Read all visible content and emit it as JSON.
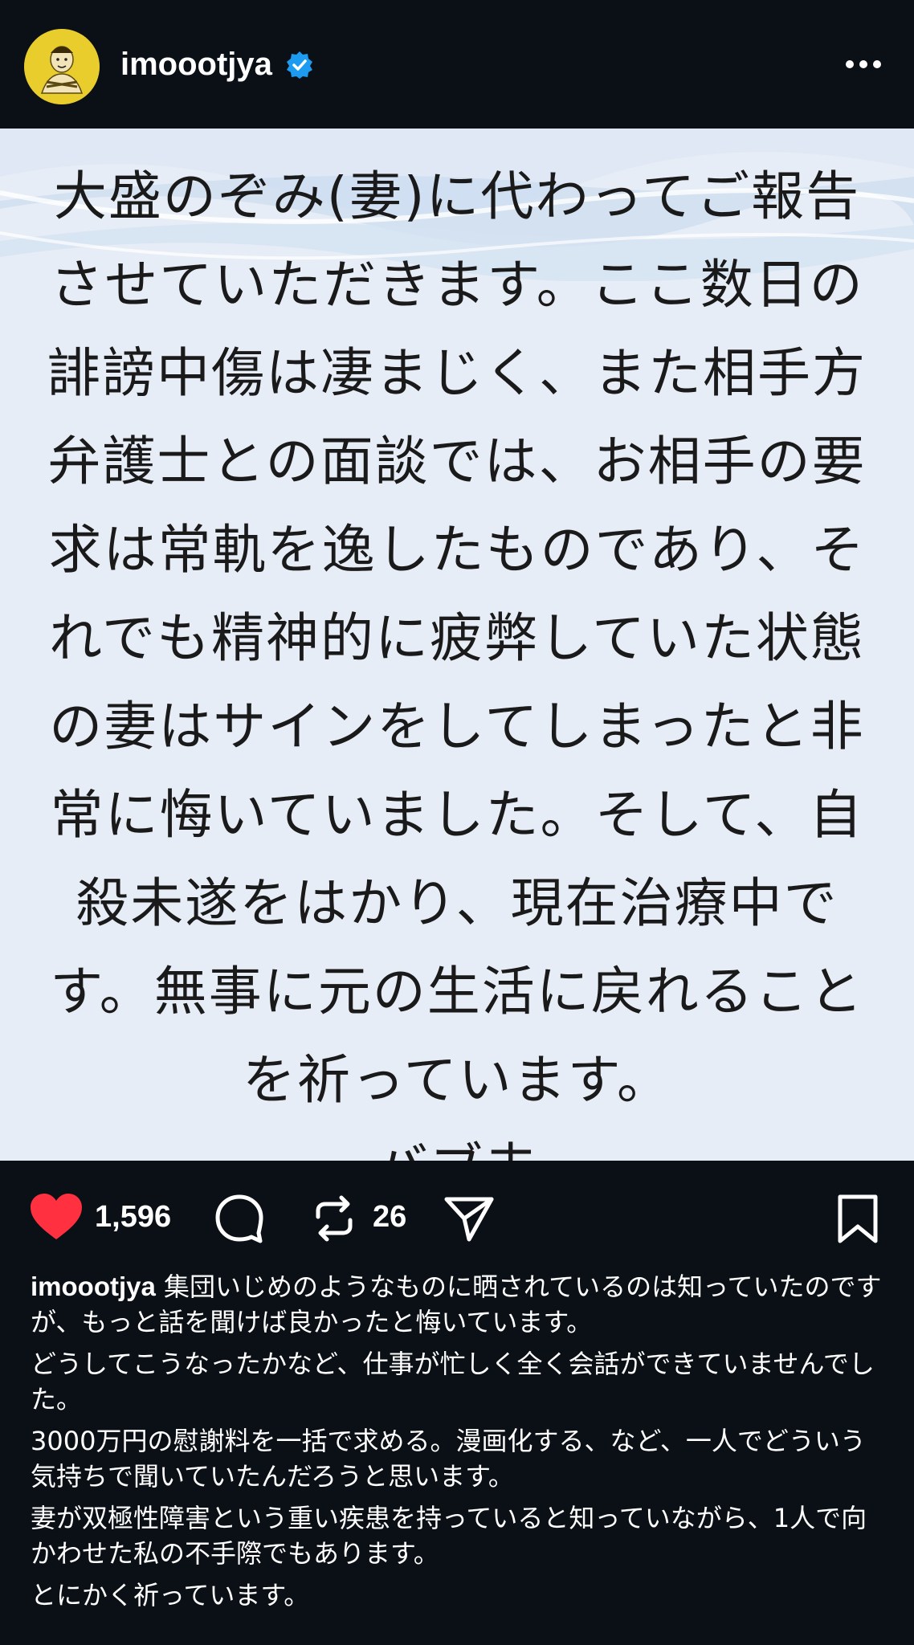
{
  "header": {
    "username": "imoootjya",
    "verified_icon": "verified-badge-icon",
    "more_icon": "more-horizontal-icon",
    "accent_color": "#1d9bf0"
  },
  "post": {
    "text": "大盛のぞみ(妻)に代わってご報告\nさせていただきます。ここ数日の\n誹謗中傷は凄まじく、また相手方\n弁護士との面談では、お相手の要\n求は常軌を逸したものであり、そ\nれでも精神的に疲弊していた状態\nの妻はサインをしてしまったと非\n常に悔いていました。そして、自\n殺未遂をはかり、現在治療中で\nす。無事に元の生活に戻れること\nを祈っています。\nバブ夫"
  },
  "actions": {
    "like_icon": "heart-filled-icon",
    "like_color": "#ff3040",
    "likes": "1,596",
    "comment_icon": "comment-icon",
    "repost_icon": "repost-icon",
    "reposts": "26",
    "share_icon": "send-icon",
    "save_icon": "bookmark-icon"
  },
  "caption": {
    "username": "imoootjya",
    "line1": " 集団いじめのようなものに晒されているのは知っていたのですが、もっと話を聞けば良かったと悔いています。",
    "line2": "どうしてこうなったかなど、仕事が忙しく全く会話ができていませんでした。",
    "line3": "3000万円の慰謝料を一括で求める。漫画化する、など、一人でどういう気持ちで聞いていたんだろうと思います。",
    "line4": "妻が双極性障害という重い疾患を持っていると知っていながら、1人で向かわせた私の不手際でもあります。",
    "line5": "とにかく祈っています。"
  }
}
